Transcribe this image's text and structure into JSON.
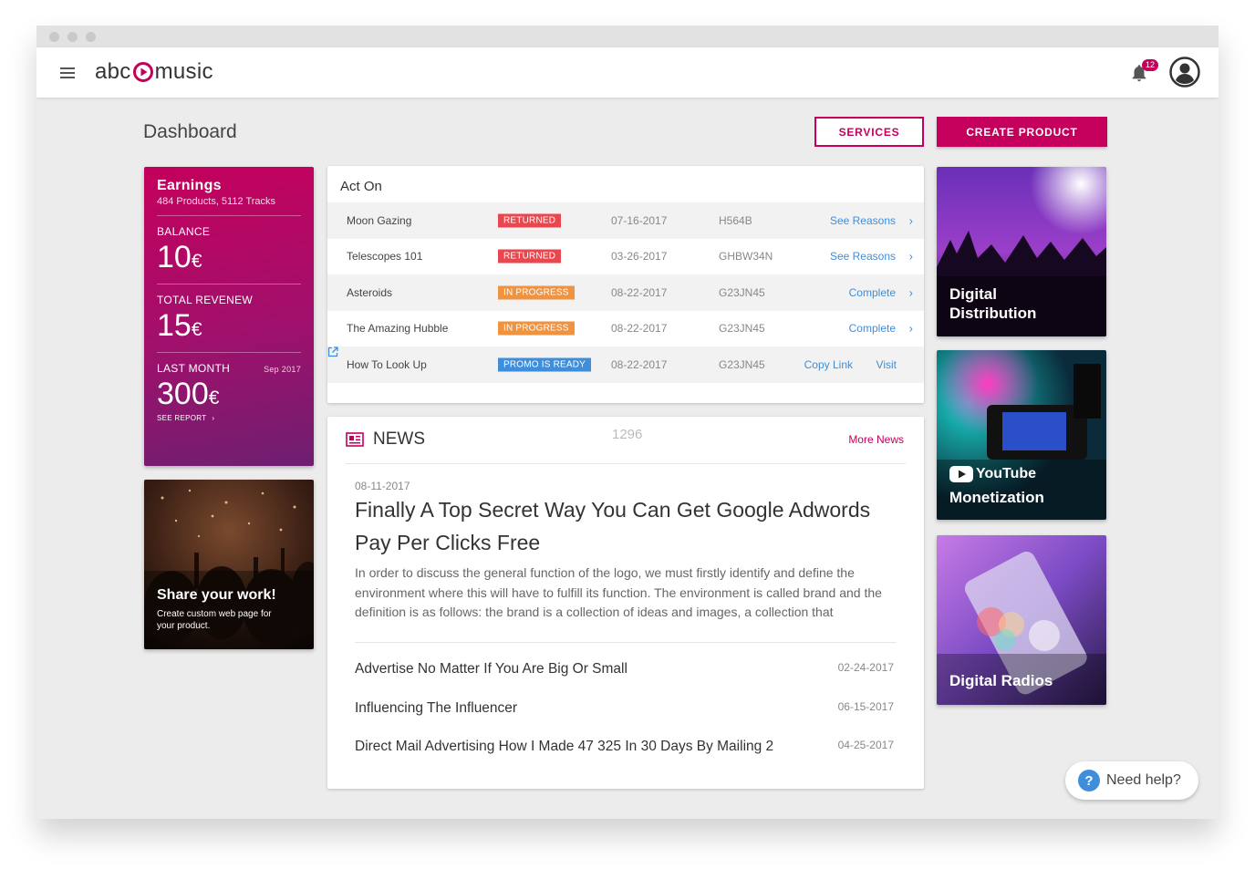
{
  "app": {
    "logo_left": "abc",
    "logo_right": "music",
    "notification_count": "12"
  },
  "page": {
    "title": "Dashboard",
    "services_label": "SERVICES",
    "create_label": "CREATE PRODUCT"
  },
  "earnings": {
    "title": "Earnings",
    "subtitle": "484 Products, 5112 Tracks",
    "balance_label": "BALANCE",
    "balance_value": "10",
    "revenue_label": "TOTAL REVENEW",
    "revenue_value": "15",
    "last_month_label": "LAST MONTH",
    "last_month_period": "Sep 2017",
    "last_month_value": "300",
    "currency": "€",
    "report_label": "SEE REPORT"
  },
  "share": {
    "title": "Share your work!",
    "description": "Create custom web page for your product."
  },
  "act_on": {
    "title": "Act On",
    "rows": [
      {
        "name": "Moon Gazing",
        "status": "RETURNED",
        "date": "07-16-2017",
        "code": "H564B",
        "action": "See Reasons"
      },
      {
        "name": "Telescopes 101",
        "status": "RETURNED",
        "date": "03-26-2017",
        "code": "GHBW34N",
        "action": "See Reasons"
      },
      {
        "name": "Asteroids",
        "status": "IN PROGRESS",
        "date": "08-22-2017",
        "code": "G23JN45",
        "action": "Complete"
      },
      {
        "name": "The Amazing Hubble",
        "status": "IN PROGRESS",
        "date": "08-22-2017",
        "code": "G23JN45",
        "action": "Complete"
      },
      {
        "name": "How To Look Up",
        "status": "PROMO IS READY",
        "date": "08-22-2017",
        "code": "G23JN45",
        "action": "Copy Link",
        "action2": "Visit"
      }
    ]
  },
  "news": {
    "title": "NEWS",
    "count": "1296",
    "more_label": "More News",
    "featured": {
      "date": "08-11-2017",
      "title": "Finally A Top Secret Way You Can Get Google Adwords Pay Per Clicks Free",
      "body": "In order to discuss the general function of the logo, we must firstly identify and define the environment where this will have to fulfill its function. The environment is called brand and the definition is as follows: the brand is a collection of ideas and images, a collection that"
    },
    "items": [
      {
        "title": "Advertise No Matter If You Are Big Or Small",
        "date": "02-24-2017"
      },
      {
        "title": "Influencing The Influencer",
        "date": "06-15-2017"
      },
      {
        "title": "Direct Mail Advertising How I Made 47 325 In 30 Days By Mailing 2",
        "date": "04-25-2017"
      }
    ]
  },
  "tiles": {
    "distribution": "Digital Distribution",
    "youtube_logo": "YouTube",
    "youtube": "Monetization",
    "radios": "Digital Radios"
  },
  "help": {
    "label": "Need help?"
  },
  "colors": {
    "accent": "#c4005c",
    "link": "#3f8edb",
    "returned": "#e9474f",
    "in_progress": "#ef9340",
    "promo": "#3f8edb"
  }
}
